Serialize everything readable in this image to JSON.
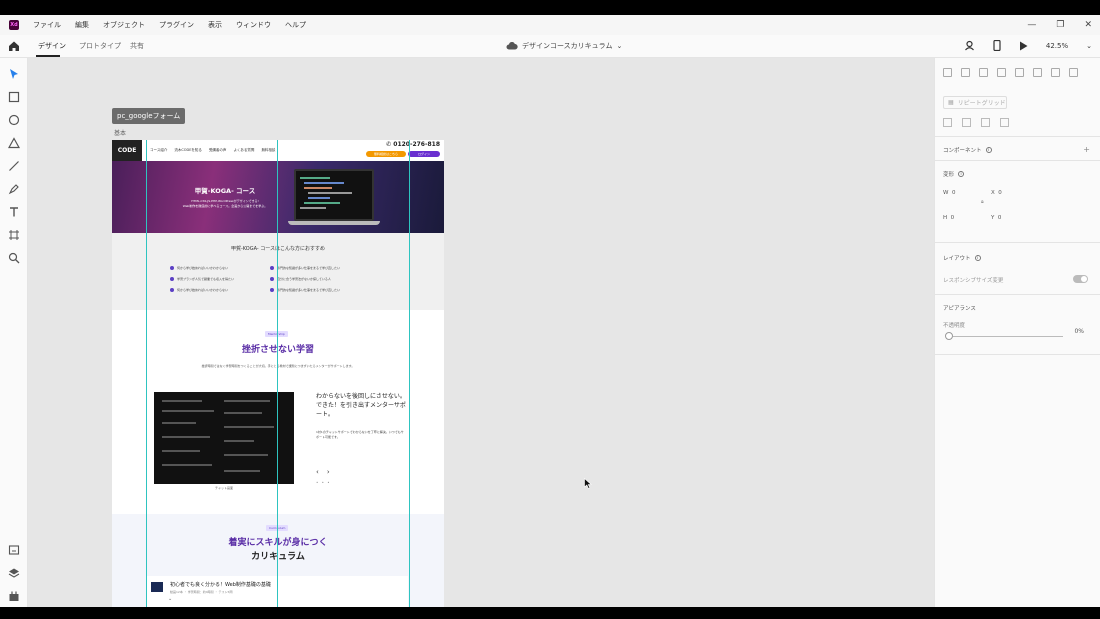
{
  "app": {
    "icon_label": "Xd"
  },
  "menu": [
    "ファイル",
    "編集",
    "オブジェクト",
    "プラグイン",
    "表示",
    "ウィンドウ",
    "ヘルプ"
  ],
  "window_controls": {
    "minimize": "—",
    "restore": "❐",
    "close": "✕"
  },
  "toolbar": {
    "tabs": [
      "デザイン",
      "プロトタイプ",
      "共有"
    ],
    "active_tab": "デザイン",
    "doc_title": "デザインコースカリキュラム",
    "zoom": "42.5%"
  },
  "canvas": {
    "artboard_name": "pc_googleフォーム",
    "artboard_sub": "基本"
  },
  "site": {
    "logo": "CODE",
    "nav": [
      "コース紹介",
      "流木CODEを知る",
      "受講者の声",
      "よくある質問",
      "無料相談"
    ],
    "phone": "0120-276-818",
    "btn_orange": "無料相談はこちら",
    "btn_purple": "ログイン",
    "hero_title": "甲賀-KOGA- コース",
    "hero_text_1": "HTML,CSS,JS,PHP,WordPressがデザインできる!",
    "hero_text_2": "Web制作を徹底的に学べるコース。企画から公開までを学ぶ。",
    "recommend_title": "甲賀-KOGA- コースはこんな方におすすめ",
    "recommend_items": [
      "何から学び始めればいいかわからない",
      "専門的な知識が多い仕事をまるで学び直したい",
      "学習プランが人気で副業でも収入を得たい",
      "自分に合う学習法がないか探している人",
      "何から学び始めればいいかわからない",
      "専門的な知識が多い仕事をまるで学び直したい"
    ],
    "sec2_badge": "Mentorship",
    "sec2_title": "挫折させない学習",
    "sec2_desc": "挫折時間ではなく学習時間をつくることが大切。手にとる教材で課題につまずいたらメンターがサポートします。",
    "chat_caption": "チャット画面",
    "mentor_title": "わからないを後回しにさせない。できた！を引き出すメンターサポート。",
    "mentor_text": "1対1のチャットサポートでわからないを丁寧に解決。いつでもサポート可能です。",
    "arrow_prev": "‹",
    "arrow_next": "›",
    "dots": "• • •",
    "sec3_badge": "Curriculum",
    "sec3_title_hl": "着実にスキルが身につく",
    "sec3_title_dark": "カリキュラム",
    "course_title": "初心者でも良く分かる！Web制作基礎の基礎",
    "course_meta": "動画12本 ・ 学習時間：約4時間 ・ テスト5問",
    "course_chev": "⌄"
  },
  "panel": {
    "repeat_grid": "リピートグリッド",
    "component": "コンポーネント",
    "transform": "変形",
    "w_label": "W",
    "w_value": "0",
    "x_label": "X",
    "x_value": "0",
    "h_label": "H",
    "h_value": "0",
    "y_label": "Y",
    "y_value": "0",
    "layout": "レイアウト",
    "responsive": "レスポンシブサイズ変更",
    "appearance": "アピアランス",
    "opacity_label": "不透明度",
    "opacity_value": "0%"
  }
}
